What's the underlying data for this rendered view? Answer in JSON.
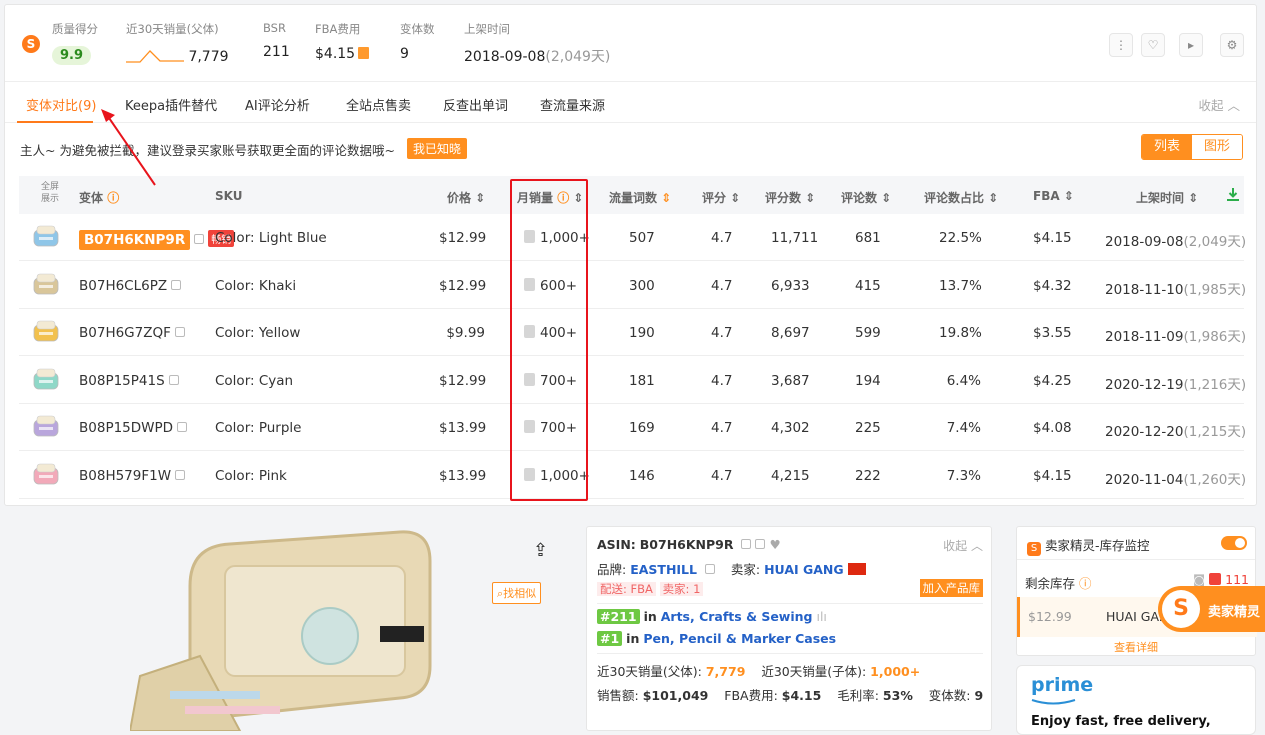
{
  "header": {
    "quality": {
      "label": "质量得分",
      "value": "9.9"
    },
    "sales30": {
      "label": "近30天销量(父体)",
      "value": "7,779"
    },
    "bsr": {
      "label": "BSR",
      "value": "211"
    },
    "fba": {
      "label": "FBA费用",
      "value": "$4.15"
    },
    "variants": {
      "label": "变体数",
      "value": "9"
    },
    "listed": {
      "label": "上架时间",
      "value": "2018-09-08",
      "sub": "(2,049天)"
    },
    "icons": [
      "more-icon",
      "heart-icon",
      "video-icon",
      "settings-icon"
    ]
  },
  "tabs": [
    "变体对比(9)",
    "Keepa插件替代",
    "AI评论分析",
    "全站点售卖",
    "反查出单词",
    "查流量来源"
  ],
  "collapse_label": "收起",
  "notice": "主人~ 为避免被拦截，建议登录买家账号获取更全面的评论数据哦~",
  "know_btn": "我已知晓",
  "view": {
    "list": "列表",
    "chart": "图形"
  },
  "table": {
    "fullscreen": "全屏\n展示",
    "headers": [
      "变体",
      "SKU",
      "价格",
      "月销量",
      "流量词数",
      "评分",
      "评分数",
      "评论数",
      "评论数占比",
      "FBA",
      "上架时间"
    ],
    "hot_tag": "畅销",
    "rows": [
      {
        "asin": "B07H6KNP9R",
        "sku": "Color: Light Blue",
        "price": "$12.99",
        "monthly": "1,000+",
        "kw": "507",
        "rating": "4.7",
        "ratings": "11,711",
        "reviews": "681",
        "share": "22.5%",
        "fba": "$4.15",
        "date": "2018-09-08",
        "days": "(2,049天)",
        "color": "#8fc6e8"
      },
      {
        "asin": "B07H6CL6PZ",
        "sku": "Color: Khaki",
        "price": "$12.99",
        "monthly": "600+",
        "kw": "300",
        "rating": "4.7",
        "ratings": "6,933",
        "reviews": "415",
        "share": "13.7%",
        "fba": "$4.32",
        "date": "2018-11-10",
        "days": "(1,985天)",
        "color": "#d9c69a"
      },
      {
        "asin": "B07H6G7ZQF",
        "sku": "Color: Yellow",
        "price": "$9.99",
        "monthly": "400+",
        "kw": "190",
        "rating": "4.7",
        "ratings": "8,697",
        "reviews": "599",
        "share": "19.8%",
        "fba": "$3.55",
        "date": "2018-11-09",
        "days": "(1,986天)",
        "color": "#f2c14e"
      },
      {
        "asin": "B08P15P41S",
        "sku": "Color: Cyan",
        "price": "$12.99",
        "monthly": "700+",
        "kw": "181",
        "rating": "4.7",
        "ratings": "3,687",
        "reviews": "194",
        "share": "6.4%",
        "fba": "$4.25",
        "date": "2020-12-19",
        "days": "(1,216天)",
        "color": "#8fd8c8"
      },
      {
        "asin": "B08P15DWPD",
        "sku": "Color: Purple",
        "price": "$13.99",
        "monthly": "700+",
        "kw": "169",
        "rating": "4.7",
        "ratings": "4,302",
        "reviews": "225",
        "share": "7.4%",
        "fba": "$4.08",
        "date": "2020-12-20",
        "days": "(1,215天)",
        "color": "#b9a6dc"
      },
      {
        "asin": "B08H579F1W",
        "sku": "Color: Pink",
        "price": "$13.99",
        "monthly": "1,000+",
        "kw": "146",
        "rating": "4.7",
        "ratings": "4,215",
        "reviews": "222",
        "share": "7.3%",
        "fba": "$4.15",
        "date": "2020-11-04",
        "days": "(1,260天)",
        "color": "#f2a9b9"
      }
    ]
  },
  "product": {
    "find_similar": "找相似",
    "asin_label": "ASIN:",
    "asin": "B07H6KNP9R",
    "brand_label": "品牌:",
    "brand": "EASTHILL",
    "seller_label": "卖家:",
    "seller": "HUAI GANG",
    "ship": "配送: FBA",
    "seller_count": "卖家: 1",
    "add_lib": "加入产品库",
    "rank1_tag": "#211",
    "rank1_in": "in",
    "rank1": "Arts, Crafts & Sewing",
    "rank2_tag": "#1",
    "rank2_in": "in",
    "rank2": "Pen, Pencil & Marker Cases",
    "parent_sales_label": "近30天销量(父体):",
    "parent_sales": "7,779",
    "child_sales_label": "近30天销量(子体):",
    "child_sales": "1,000+",
    "revenue_label": "销售额:",
    "revenue": "$101,049",
    "fba_label": "FBA费用:",
    "fba": "$4.15",
    "margin_label": "毛利率:",
    "margin": "53%",
    "variant_label": "变体数:",
    "variants": "9"
  },
  "stock": {
    "title": "卖家精灵-库存监控",
    "remain_label": "剩余库存",
    "count": "111",
    "price": "$12.99",
    "seller": "HUAI GA...",
    "details": "查看详细"
  },
  "floating": {
    "label": "卖家精灵"
  },
  "prime": {
    "logo": "prime",
    "text": "Enjoy fast, free delivery,"
  }
}
